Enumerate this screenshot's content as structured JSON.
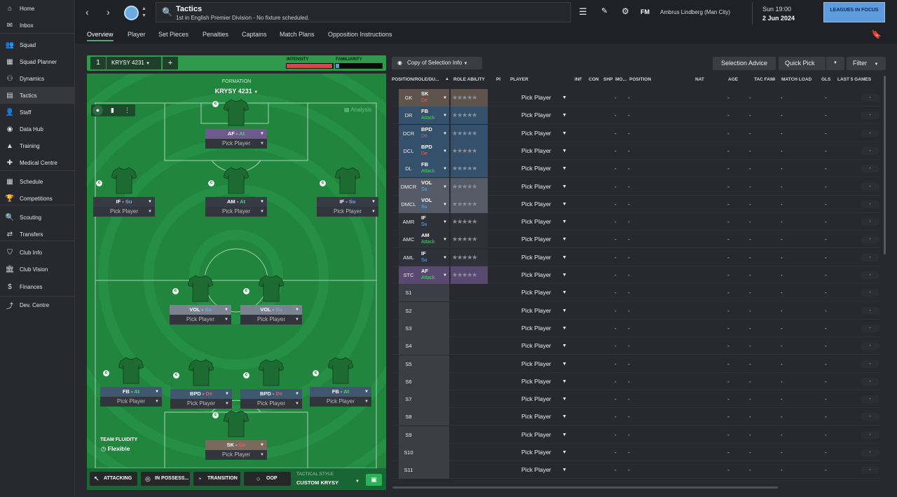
{
  "sidebar": {
    "items": [
      {
        "label": "Home",
        "icon": "home-icon",
        "glyph": "⌂"
      },
      {
        "label": "Inbox",
        "icon": "inbox-icon",
        "glyph": "✉"
      },
      {
        "label": "Squad",
        "icon": "squad-icon",
        "glyph": "👥"
      },
      {
        "label": "Squad Planner",
        "icon": "squad-planner-icon",
        "glyph": "▦"
      },
      {
        "label": "Dynamics",
        "icon": "dynamics-icon",
        "glyph": "⚇"
      },
      {
        "label": "Tactics",
        "icon": "tactics-icon",
        "glyph": "▤"
      },
      {
        "label": "Staff",
        "icon": "staff-icon",
        "glyph": "👤"
      },
      {
        "label": "Data Hub",
        "icon": "data-hub-icon",
        "glyph": "◉"
      },
      {
        "label": "Training",
        "icon": "training-icon",
        "glyph": "▲"
      },
      {
        "label": "Medical Centre",
        "icon": "medical-icon",
        "glyph": "✚"
      },
      {
        "label": "Schedule",
        "icon": "calendar-icon",
        "glyph": "▦"
      },
      {
        "label": "Competitions",
        "icon": "trophy-icon",
        "glyph": "🏆"
      },
      {
        "label": "Scouting",
        "icon": "scouting-icon",
        "glyph": "🔍"
      },
      {
        "label": "Transfers",
        "icon": "transfers-icon",
        "glyph": "⇄"
      },
      {
        "label": "Club Info",
        "icon": "club-info-icon",
        "glyph": "⛉"
      },
      {
        "label": "Club Vision",
        "icon": "club-vision-icon",
        "glyph": "🏛"
      },
      {
        "label": "Finances",
        "icon": "finances-icon",
        "glyph": "$"
      },
      {
        "label": "Dev. Centre",
        "icon": "dev-centre-icon",
        "glyph": "⤴"
      }
    ]
  },
  "header": {
    "title": "Tactics",
    "subtitle": "1st in English Premier Division - No fixture scheduled.",
    "fm": "FM",
    "manager": "Ambrus Lindberg (Man City)",
    "time": "Sun 19:00",
    "date": "2 Jun 2024",
    "leagues_btn": "LEAGUES IN FOCUS"
  },
  "subnav": [
    "Overview",
    "Player",
    "Set Pieces",
    "Penalties",
    "Captains",
    "Match Plans",
    "Opposition Instructions"
  ],
  "tactic": {
    "number": "1",
    "name": "KRYSY 4231",
    "intensity_label": "INTENSITY",
    "familiarity_label": "FAMILIARITY",
    "intensity": 0.98,
    "familiarity": 0.08,
    "intensity_color": "#e0414a",
    "familiarity_color": "#4aa3dc"
  },
  "pitch": {
    "formation_label": "FORMATION",
    "formation_name": "KRYSY 4231",
    "analysis": "Analysis",
    "fluidity_label": "TEAM FLUIDITY",
    "fluidity_value": "Flexible",
    "players": [
      {
        "role": "AF",
        "duty": "At",
        "pick": "Pick Player",
        "color": "#6e5a8c"
      },
      {
        "role": "IF",
        "duty": "Su",
        "pick": "Pick Player",
        "color": "#373b45"
      },
      {
        "role": "AM",
        "duty": "At",
        "pick": "Pick Player",
        "color": "#373b45"
      },
      {
        "role": "IF",
        "duty": "Su",
        "pick": "Pick Player",
        "color": "#373b45"
      },
      {
        "role": "VOL",
        "duty": "Su",
        "pick": "Pick Player",
        "color": "#7b8290"
      },
      {
        "role": "VOL",
        "duty": "Su",
        "pick": "Pick Player",
        "color": "#7b8290"
      },
      {
        "role": "FB",
        "duty": "At",
        "pick": "Pick Player",
        "color": "#3f5870"
      },
      {
        "role": "BPD",
        "duty": "De",
        "pick": "Pick Player",
        "color": "#3f5870"
      },
      {
        "role": "BPD",
        "duty": "De",
        "pick": "Pick Player",
        "color": "#3f5870"
      },
      {
        "role": "FB",
        "duty": "At",
        "pick": "Pick Player",
        "color": "#3f5870"
      },
      {
        "role": "SK",
        "duty": "De",
        "pick": "Pick Player",
        "color": "#7a6a5c"
      }
    ]
  },
  "footer": {
    "attacking": "ATTACKING",
    "in_possession": "IN POSSESS...",
    "transition": "TRANSITION",
    "oop": "OOP",
    "style_label": "TACTICAL STYLE",
    "style_value": "CUSTOM KRYSY"
  },
  "selection": {
    "copy": "Copy of Selection Info",
    "advice": "Selection Advice",
    "quick_pick": "Quick Pick",
    "filter": "Filter"
  },
  "table": {
    "columns": [
      "POSITION/ROLE/DU...",
      "ROLE ABILITY",
      "PI",
      "PLAYER",
      "INF",
      "CON",
      "SHP",
      "MO...",
      "POSITION",
      "NAT",
      "AGE",
      "TAC FAMI",
      "MATCH LOAD",
      "GLS",
      "LAST 5 GAMES"
    ],
    "pick": "Pick Player",
    "dash": "-",
    "rows": [
      {
        "pos": "GK",
        "role": "SK",
        "duty": "De",
        "pos_color": "#5e544b",
        "role_color": "#5e544b",
        "duty_color": "#e85a5a"
      },
      {
        "pos": "DR",
        "role": "FB",
        "duty": "Attack",
        "pos_color": "#34506a",
        "role_color": "#34506a",
        "duty_color": "#4cd36f"
      },
      {
        "pos": "DCR",
        "role": "BPD",
        "duty": "De",
        "pos_color": "#34506a",
        "role_color": "#34506a",
        "duty_color": "#e85a5a"
      },
      {
        "pos": "DCL",
        "role": "BPD",
        "duty": "De",
        "pos_color": "#34506a",
        "role_color": "#34506a",
        "duty_color": "#e85a5a"
      },
      {
        "pos": "DL",
        "role": "FB",
        "duty": "Attack",
        "pos_color": "#34506a",
        "role_color": "#34506a",
        "duty_color": "#4cd36f"
      },
      {
        "pos": "DMCR",
        "role": "VOL",
        "duty": "Su",
        "pos_color": "#545a66",
        "role_color": "#545a66",
        "duty_color": "#6aaaf0"
      },
      {
        "pos": "DMCL",
        "role": "VOL",
        "duty": "Su",
        "pos_color": "#545a66",
        "role_color": "#545a66",
        "duty_color": "#6aaaf0"
      },
      {
        "pos": "AMR",
        "role": "IF",
        "duty": "Su",
        "pos_color": "#2e3138",
        "role_color": "#2e3138",
        "duty_color": "#6aaaf0"
      },
      {
        "pos": "AMC",
        "role": "AM",
        "duty": "Attack",
        "pos_color": "#2e3138",
        "role_color": "#2e3138",
        "duty_color": "#4cd36f"
      },
      {
        "pos": "AML",
        "role": "IF",
        "duty": "Su",
        "pos_color": "#2e3138",
        "role_color": "#2e3138",
        "duty_color": "#6aaaf0"
      },
      {
        "pos": "STC",
        "role": "AF",
        "duty": "Attack",
        "pos_color": "#584970",
        "role_color": "#584970",
        "duty_color": "#4cd36f"
      },
      {
        "pos": "S1"
      },
      {
        "pos": "S2"
      },
      {
        "pos": "S3"
      },
      {
        "pos": "S4"
      },
      {
        "pos": "S5"
      },
      {
        "pos": "S6"
      },
      {
        "pos": "S7"
      },
      {
        "pos": "S8"
      },
      {
        "pos": "S9"
      },
      {
        "pos": "S10"
      },
      {
        "pos": "S11"
      }
    ]
  }
}
